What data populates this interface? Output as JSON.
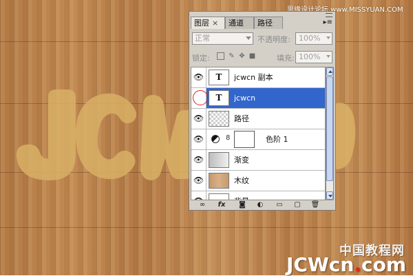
{
  "panel": {
    "tabs": [
      {
        "label": "图层",
        "close": "×"
      },
      {
        "label": "通道"
      },
      {
        "label": "路径"
      }
    ],
    "blend_mode": "正常",
    "opacity_label": "不透明度:",
    "opacity_value": "100%",
    "lock_label": "锁定:",
    "fill_label": "填充:",
    "fill_value": "100%",
    "layers": [
      {
        "name": "jcwcn 副本",
        "thumb": "T",
        "visible": true,
        "selected": false
      },
      {
        "name": "jcwcn",
        "thumb": "T",
        "visible": false,
        "selected": true
      },
      {
        "name": "路径",
        "thumb": "checker",
        "visible": true,
        "selected": false
      },
      {
        "name": "色阶 1",
        "thumb": "adjustment",
        "visible": true,
        "selected": false
      },
      {
        "name": "渐变",
        "thumb": "gradient",
        "visible": true,
        "selected": false
      },
      {
        "name": "木纹",
        "thumb": "wood",
        "visible": true,
        "selected": false
      },
      {
        "name": "背景",
        "thumb": "white",
        "visible": true,
        "selected": false
      }
    ],
    "footer_icons": [
      "link-icon",
      "fx-icon",
      "mask-icon",
      "adjustment-icon",
      "folder-icon",
      "new-layer-icon",
      "trash-icon"
    ]
  },
  "watermarks": {
    "top": "思缘设计论坛 www.MISSYUAN.COM",
    "bottom_cn": "中国教程网",
    "bottom_latin_a": "JCWcn",
    "bottom_dot": ".",
    "bottom_latin_b": "com"
  },
  "canvas": {
    "bubble_text": "JCWcn",
    "colors": {
      "wood": "#c28a52",
      "bubble": "#d9b066",
      "selection": "#3366cc"
    }
  }
}
